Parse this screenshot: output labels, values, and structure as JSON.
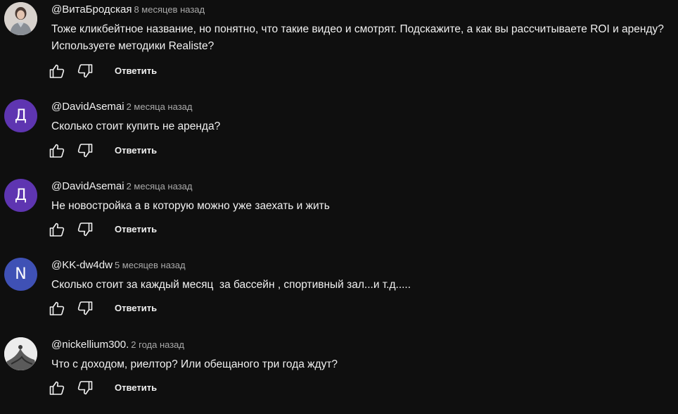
{
  "colors": {
    "background": "#0f0f0f",
    "text_primary": "#f1f1f1",
    "text_secondary": "#aaaaaa",
    "avatar_d": "#5e35b1",
    "avatar_n": "#3f51b5"
  },
  "comments": [
    {
      "author": "@ВитаБродская",
      "time": "8 месяцев назад",
      "text": "Тоже кликбейтное название, но понятно, что такие видео и смотрят. Подскажите, а как вы рассчитываете ROI и аренду? Используете методики Realiste?",
      "avatar_type": "photo",
      "avatar_icon": "user-photo-icon",
      "reply_label": "Ответить"
    },
    {
      "author": "@DavidAsemai",
      "time": "2 месяца назад",
      "text": "Сколько стоит купить не аренда?",
      "avatar_type": "letter",
      "avatar_letter": "Д",
      "avatar_color": "#5e35b1",
      "reply_label": "Ответить"
    },
    {
      "author": "@DavidAsemai",
      "time": "2 месяца назад",
      "text": "Не новостройка а в которую можно уже заехать и жить",
      "avatar_type": "letter",
      "avatar_letter": "Д",
      "avatar_color": "#5e35b1",
      "reply_label": "Ответить"
    },
    {
      "author": "@KK-dw4dw",
      "time": "5 месяцев назад",
      "text": "Сколько стоит за каждый месяц  за бассейн , спортивный зал...и т.д.....",
      "avatar_type": "letter",
      "avatar_letter": "N",
      "avatar_color": "#3f51b5",
      "reply_label": "Ответить"
    },
    {
      "author": "@nickellium300.",
      "time": "2 года назад",
      "text": "Что с доходом, риелтор? Или обещаного три года ждут?",
      "avatar_type": "photo",
      "avatar_icon": "user-photo-icon",
      "reply_label": "Ответить"
    }
  ]
}
